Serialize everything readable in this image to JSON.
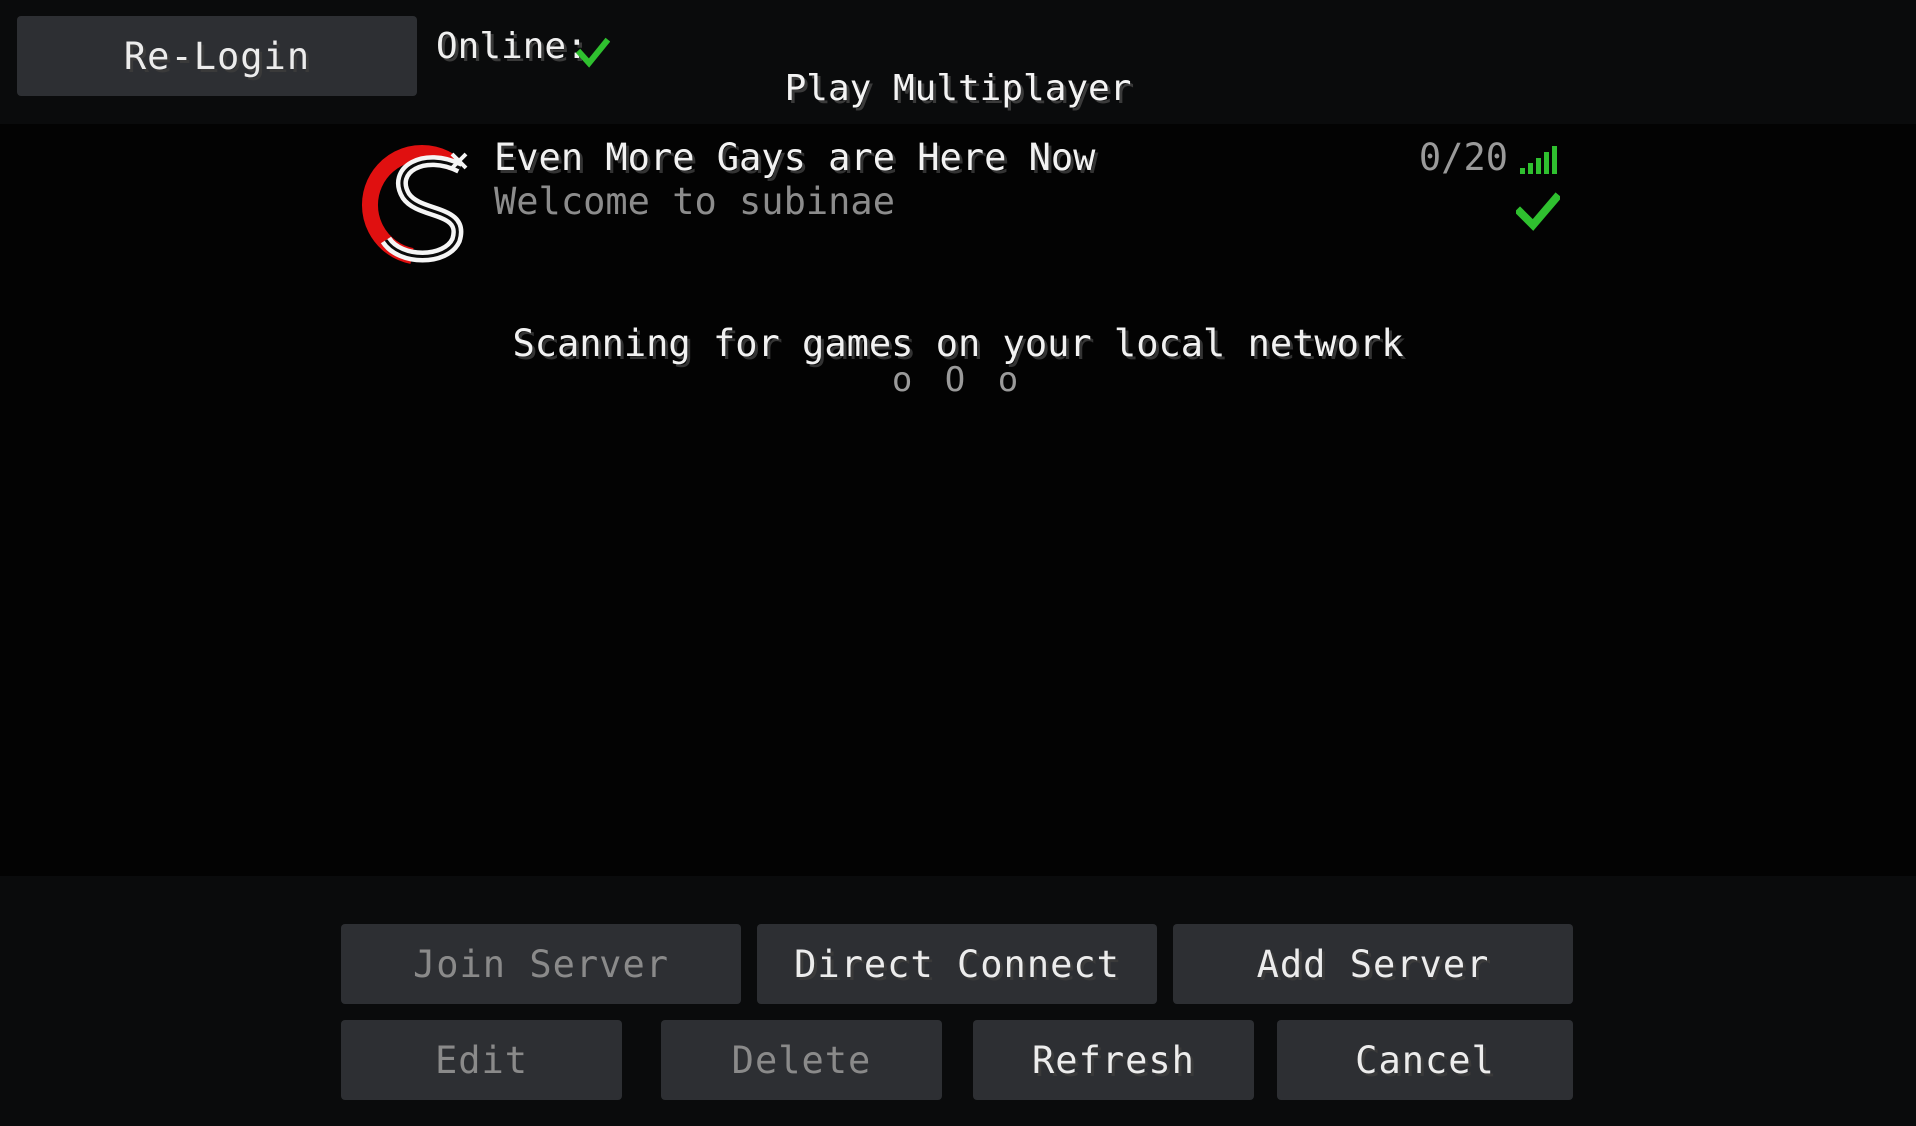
{
  "header": {
    "relogin_label": "Re-Login",
    "online_label": "Online:",
    "online_status_icon": "check-icon",
    "title": "Play Multiplayer"
  },
  "servers": [
    {
      "icon": "server-logo-s",
      "name": "Even More Gays are Here Now",
      "motd": "Welcome to subinae",
      "players": "0/20",
      "signal_icon": "signal-bars-icon",
      "status_icon": "check-icon"
    }
  ],
  "lan_scan": {
    "text": "Scanning for games on your local network",
    "indicator": "o O o"
  },
  "buttons": {
    "join": "Join Server",
    "direct": "Direct Connect",
    "add": "Add Server",
    "edit": "Edit",
    "delete": "Delete",
    "refresh": "Refresh",
    "cancel": "Cancel"
  },
  "colors": {
    "accent_green": "#2fc02f",
    "button_bg": "#2d2f33",
    "disabled_text": "#8a8a8a",
    "logo_red": "#e01010"
  }
}
